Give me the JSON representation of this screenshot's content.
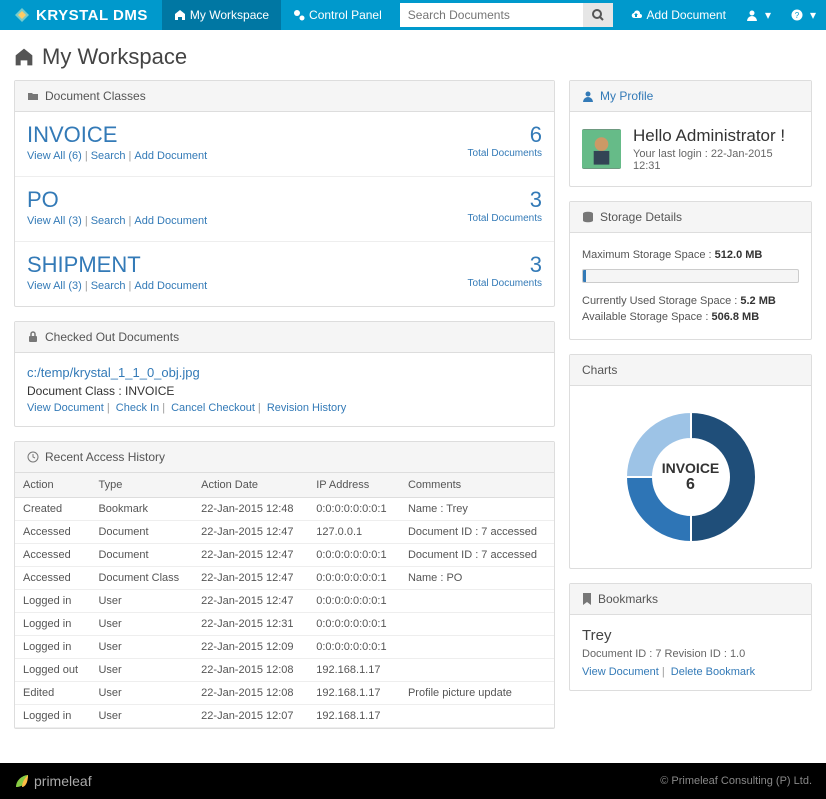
{
  "navbar": {
    "brand": "KRYSTAL DMS",
    "workspace": "My Workspace",
    "control_panel": "Control Panel",
    "search_placeholder": "Search Documents",
    "add_document": "Add Document"
  },
  "page_title": "My Workspace",
  "doc_classes_heading": "Document Classes",
  "doc_classes": [
    {
      "name": "INVOICE",
      "view": "View All (6)",
      "search": "Search",
      "add": "Add Document",
      "count": "6",
      "total": "Total Documents"
    },
    {
      "name": "PO",
      "view": "View All (3)",
      "search": "Search",
      "add": "Add Document",
      "count": "3",
      "total": "Total Documents"
    },
    {
      "name": "SHIPMENT",
      "view": "View All (3)",
      "search": "Search",
      "add": "Add Document",
      "count": "3",
      "total": "Total Documents"
    }
  ],
  "checked_out_heading": "Checked Out Documents",
  "checked_out": {
    "file": "c:/temp/krystal_1_1_0_obj.jpg",
    "class": "Document Class : INVOICE",
    "view": "View Document",
    "checkin": "Check In",
    "cancel": "Cancel Checkout",
    "revision": "Revision History"
  },
  "history_heading": "Recent Access History",
  "history_headers": {
    "action": "Action",
    "type": "Type",
    "date": "Action Date",
    "ip": "IP Address",
    "comments": "Comments"
  },
  "history": [
    {
      "action": "Created",
      "type": "Bookmark",
      "date": "22-Jan-2015 12:48",
      "ip": "0:0:0:0:0:0:0:1",
      "comments": "Name : Trey"
    },
    {
      "action": "Accessed",
      "type": "Document",
      "date": "22-Jan-2015 12:47",
      "ip": "127.0.0.1",
      "comments": "Document ID : 7 accessed"
    },
    {
      "action": "Accessed",
      "type": "Document",
      "date": "22-Jan-2015 12:47",
      "ip": "0:0:0:0:0:0:0:1",
      "comments": "Document ID : 7 accessed"
    },
    {
      "action": "Accessed",
      "type": "Document Class",
      "date": "22-Jan-2015 12:47",
      "ip": "0:0:0:0:0:0:0:1",
      "comments": "Name : PO"
    },
    {
      "action": "Logged in",
      "type": "User",
      "date": "22-Jan-2015 12:47",
      "ip": "0:0:0:0:0:0:0:1",
      "comments": ""
    },
    {
      "action": "Logged in",
      "type": "User",
      "date": "22-Jan-2015 12:31",
      "ip": "0:0:0:0:0:0:0:1",
      "comments": ""
    },
    {
      "action": "Logged in",
      "type": "User",
      "date": "22-Jan-2015 12:09",
      "ip": "0:0:0:0:0:0:0:1",
      "comments": ""
    },
    {
      "action": "Logged out",
      "type": "User",
      "date": "22-Jan-2015 12:08",
      "ip": "192.168.1.17",
      "comments": ""
    },
    {
      "action": "Edited",
      "type": "User",
      "date": "22-Jan-2015 12:08",
      "ip": "192.168.1.17",
      "comments": "Profile picture update"
    },
    {
      "action": "Logged in",
      "type": "User",
      "date": "22-Jan-2015 12:07",
      "ip": "192.168.1.17",
      "comments": ""
    }
  ],
  "profile": {
    "heading": "My Profile",
    "greeting": "Hello Administrator !",
    "last_login": "Your last login : 22-Jan-2015 12:31"
  },
  "storage": {
    "heading": "Storage Details",
    "max_label": "Maximum Storage Space : ",
    "max_val": "512.0 MB",
    "used_label": "Currently Used Storage Space : ",
    "used_val": "5.2 MB",
    "avail_label": "Available Storage Space : ",
    "avail_val": "506.8 MB"
  },
  "charts_heading": "Charts",
  "chart_data": {
    "type": "pie",
    "title": "",
    "center_label": "INVOICE",
    "center_value": "6",
    "series": [
      {
        "name": "INVOICE",
        "value": 6,
        "color": "#1f4e79"
      },
      {
        "name": "PO",
        "value": 3,
        "color": "#2e75b6"
      },
      {
        "name": "SHIPMENT",
        "value": 3,
        "color": "#9dc3e6"
      }
    ]
  },
  "bookmarks": {
    "heading": "Bookmarks",
    "name": "Trey",
    "meta": "Document ID : 7 Revision ID : 1.0",
    "view": "View Document",
    "delete": "Delete Bookmark"
  },
  "footer": {
    "brand": "primeleaf",
    "copyright": "© Primeleaf Consulting (P) Ltd."
  }
}
